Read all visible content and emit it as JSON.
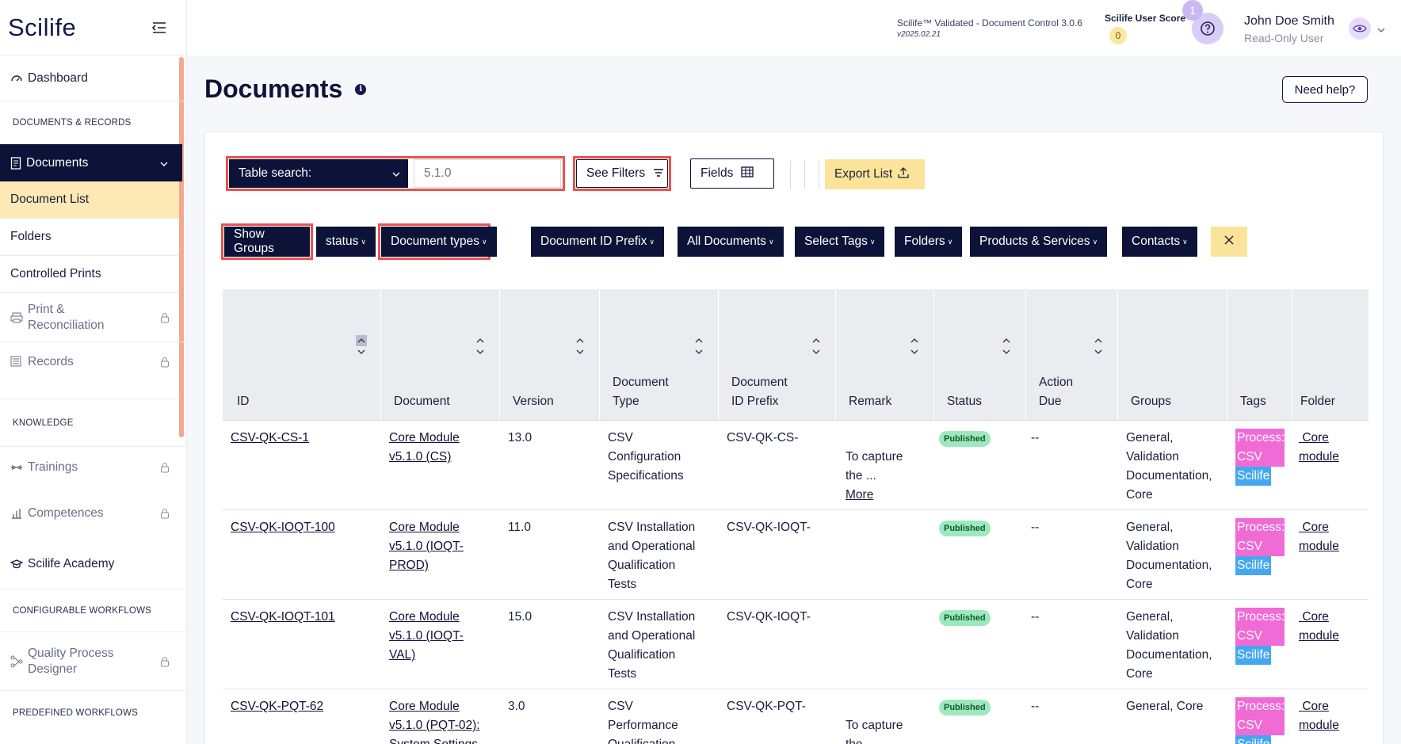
{
  "app": {
    "logo": "Scilife"
  },
  "header": {
    "product_name": "Scilife™ Validated - Document Control 3.0.6",
    "product_version": "v2025.02.21",
    "score_label": "Scilife User Score",
    "score_value": "0",
    "notification_count": "1",
    "user_name": "John Doe Smith",
    "user_role": "Read-Only User"
  },
  "sidebar": {
    "dashboard": "Dashboard",
    "section_docs": "DOCUMENTS & RECORDS",
    "documents": "Documents",
    "document_list": "Document List",
    "folders": "Folders",
    "controlled_prints": "Controlled Prints",
    "print_reconciliation_1": "Print &",
    "print_reconciliation_2": "Reconciliation",
    "records": "Records",
    "section_knowledge": "KNOWLEDGE",
    "trainings": "Trainings",
    "competences": "Competences",
    "academy": "Scilife Academy",
    "section_workflows": "CONFIGURABLE WORKFLOWS",
    "qpd_1": "Quality Process",
    "qpd_2": "Designer",
    "section_predefined": "PREDEFINED WORKFLOWS"
  },
  "page": {
    "title": "Documents",
    "help_button": "Need help?"
  },
  "toolbar": {
    "search_label": "Table search:",
    "search_value": "5.1.0",
    "see_filters": "See Filters",
    "fields": "Fields",
    "export": "Export List"
  },
  "filters": {
    "show_groups": "Show Groups",
    "status": "status",
    "doc_types": "Document types",
    "id_prefix": "Document ID Prefix",
    "all_docs": "All Documents",
    "tags": "Select Tags",
    "folders": "Folders",
    "products": "Products & Services",
    "contacts": "Contacts"
  },
  "table": {
    "columns": {
      "id": "ID",
      "document": "Document",
      "version": "Version",
      "doc_type_1": "Document",
      "doc_type_2": "Type",
      "prefix_1": "Document",
      "prefix_2": "ID Prefix",
      "remark": "Remark",
      "status": "Status",
      "action_due_1": "Action",
      "action_due_2": "Due",
      "groups": "Groups",
      "tags": "Tags",
      "folder": "Folder"
    },
    "rows": [
      {
        "id": "CSV-QK-CS-1",
        "doc": [
          "Core Module",
          "v5.1.0 (CS)"
        ],
        "version": "13.0",
        "type": [
          "CSV",
          "Configuration",
          "Specifications"
        ],
        "prefix": "CSV-QK-CS-",
        "remark": [
          "To capture",
          "the ..."
        ],
        "remark_more": "More",
        "status": "Published",
        "due": "--",
        "groups": [
          "General,",
          "Validation",
          "Documentation,",
          "Core"
        ],
        "tag1": "Process:",
        "tag2": "CSV",
        "tag3": "Scilife",
        "folder": [
          "Core",
          "module"
        ]
      },
      {
        "id": "CSV-QK-IOQT-100",
        "doc": [
          "Core Module",
          "v5.1.0 (IOQT-",
          "PROD)"
        ],
        "version": "11.0",
        "type": [
          "CSV Installation",
          "and Operational",
          "Qualification",
          "Tests"
        ],
        "prefix": "CSV-QK-IOQT-",
        "status": "Published",
        "due": "--",
        "groups": [
          "General,",
          "Validation",
          "Documentation,",
          "Core"
        ],
        "tag1": "Process:",
        "tag2": "CSV",
        "tag3": "Scilife",
        "folder": [
          "Core",
          "module"
        ]
      },
      {
        "id": "CSV-QK-IOQT-101",
        "doc": [
          "Core Module",
          "v5.1.0 (IOQT-",
          "VAL)"
        ],
        "version": "15.0",
        "type": [
          "CSV Installation",
          "and Operational",
          "Qualification",
          "Tests"
        ],
        "prefix": "CSV-QK-IOQT-",
        "status": "Published",
        "due": "--",
        "groups": [
          "General,",
          "Validation",
          "Documentation,",
          "Core"
        ],
        "tag1": "Process:",
        "tag2": "CSV",
        "tag3": "Scilife",
        "folder": [
          "Core",
          "module"
        ]
      },
      {
        "id": "CSV-QK-PQT-62",
        "doc": [
          "Core Module",
          "v5.1.0 (PQT-02):",
          "System Settings"
        ],
        "version": "3.0",
        "type": [
          "CSV",
          "Performance",
          "Qualification"
        ],
        "prefix": "CSV-QK-PQT-",
        "remark": [
          "To capture",
          "the"
        ],
        "status": "Published",
        "due": "--",
        "groups": [
          "General, Core"
        ],
        "tag1": "Process:",
        "tag2": "CSV",
        "tag3": "Scilife",
        "folder": [
          "Core",
          "module"
        ]
      }
    ]
  },
  "colors": {
    "navy": "#0c1238",
    "highlight": "#fce9b6",
    "accent_yellow": "#fbe49a",
    "outline_red": "#e7534f",
    "published_green": "#9de8bd",
    "tag_pink": "#f06bd6",
    "tag_blue": "#45a8ef"
  },
  "icons": [
    "menu-collapse-icon",
    "dashboard-icon",
    "document-icon",
    "chevron-down-icon",
    "lock-icon",
    "records-icon",
    "print-icon",
    "trainings-icon",
    "competences-icon",
    "academy-icon",
    "workflow-icon",
    "help-icon",
    "avatar-eye-icon",
    "info-icon",
    "filter-lines-icon",
    "table-grid-icon",
    "upload-icon",
    "close-icon",
    "sort-icon"
  ]
}
